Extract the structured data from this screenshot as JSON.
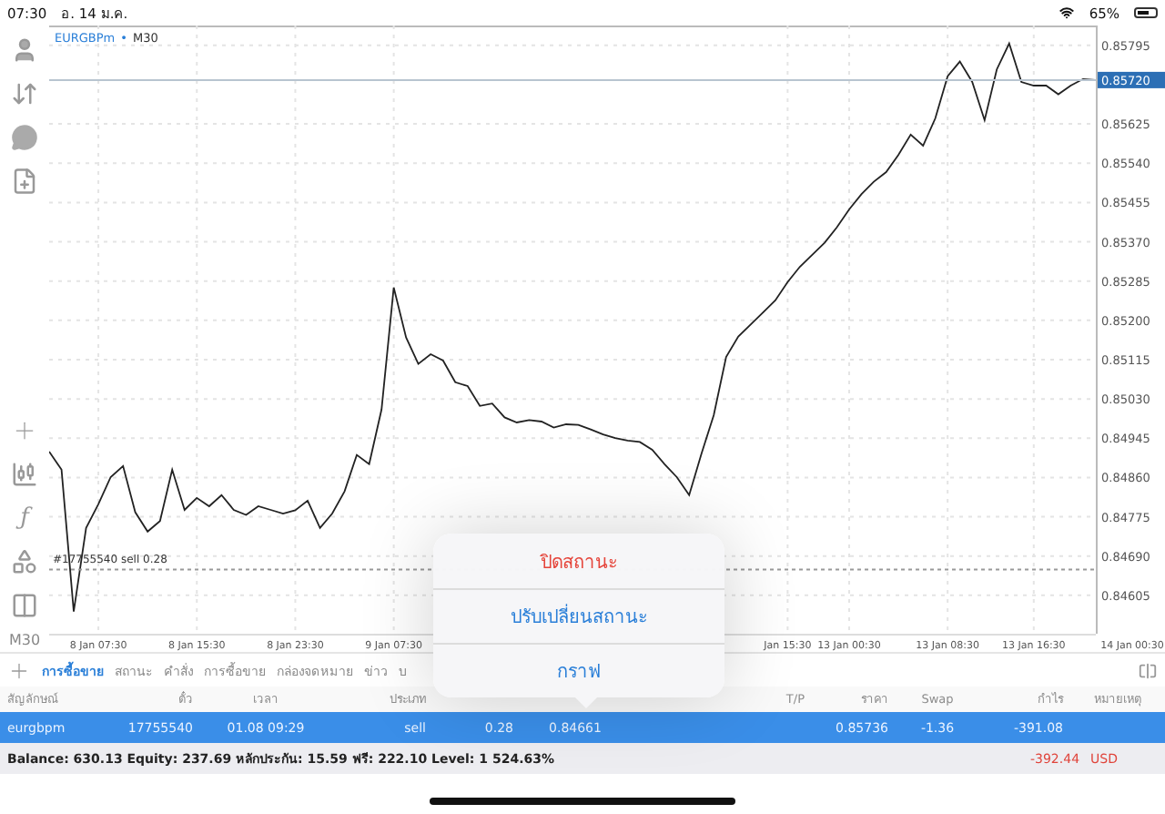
{
  "status_bar": {
    "time": "07:30",
    "date": "อ. 14 ม.ค.",
    "battery": "65%"
  },
  "toolbar": {
    "indicator": "ƒ",
    "timeframe": "M30"
  },
  "chart": {
    "symbol": "EURGBPm",
    "separator": "•",
    "timeframe": "M30",
    "chart_data": {
      "type": "line",
      "categories": [
        null,
        null,
        null,
        null,
        "8 Jan 07:30",
        null,
        null,
        null,
        null,
        null,
        null,
        null,
        "8 Jan 15:30",
        null,
        null,
        null,
        null,
        null,
        null,
        null,
        "8 Jan 23:30",
        null,
        null,
        null,
        null,
        null,
        null,
        null,
        "9 Jan 07:30",
        null,
        null,
        null,
        null,
        null,
        null,
        null,
        null,
        null,
        null,
        null,
        null,
        null,
        null,
        null,
        null,
        null,
        null,
        null,
        null,
        null,
        null,
        null,
        null,
        null,
        null,
        null,
        null,
        null,
        null,
        null,
        "Jan 15:30",
        null,
        null,
        null,
        null,
        "13 Jan 00:30",
        null,
        null,
        null,
        null,
        null,
        null,
        null,
        "13 Jan 08:30",
        null,
        null,
        null,
        null,
        null,
        null,
        "13 Jan 16:30",
        null,
        null,
        null,
        null,
        null,
        null,
        null,
        "14 Jan 00:30"
      ],
      "grid": true,
      "series": [
        {
          "color": "#222222",
          "values": [
            0.84916,
            0.84877,
            0.8457,
            0.84751,
            0.84802,
            0.84861,
            0.84885,
            0.84785,
            0.84743,
            0.84766,
            0.84877,
            0.8479,
            0.84816,
            0.84798,
            0.84822,
            0.8479,
            0.84779,
            0.84798,
            0.8479,
            0.84782,
            0.84789,
            0.8481,
            0.84751,
            0.84782,
            0.8483,
            0.84909,
            0.84889,
            0.85007,
            0.85271,
            0.85163,
            0.85106,
            0.85127,
            0.85113,
            0.85066,
            0.85058,
            0.85015,
            0.8502,
            0.8499,
            0.84979,
            0.84984,
            0.84981,
            0.84968,
            0.84975,
            0.84974,
            0.84964,
            0.84953,
            0.84945,
            0.8494,
            0.84937,
            0.8492,
            0.84889,
            0.84861,
            0.84822,
            0.84912,
            0.84995,
            0.85121,
            0.85165,
            0.85191,
            0.85217,
            0.85243,
            0.85283,
            0.85316,
            0.85342,
            0.85368,
            0.85401,
            0.8544,
            0.85473,
            0.855,
            0.85521,
            0.85558,
            0.85602,
            0.85578,
            0.85637,
            0.85728,
            0.8576,
            0.85716,
            0.85633,
            0.85743,
            0.85799,
            0.85716,
            0.85708,
            0.85708,
            0.85689,
            0.85708,
            0.85722,
            0.8572,
            null,
            null,
            null
          ]
        }
      ],
      "ylim": [
        0.84522,
        0.85838
      ],
      "yticks": [
        {
          "value": 0.85795,
          "label": "0.85795"
        },
        {
          "value": 0.85625,
          "label": "0.85625"
        },
        {
          "value": 0.8554,
          "label": "0.85540"
        },
        {
          "value": 0.85455,
          "label": "0.85455"
        },
        {
          "value": 0.8537,
          "label": "0.85370"
        },
        {
          "value": 0.85285,
          "label": "0.85285"
        },
        {
          "value": 0.852,
          "label": "0.85200"
        },
        {
          "value": 0.85115,
          "label": "0.85115"
        },
        {
          "value": 0.8503,
          "label": "0.85030"
        },
        {
          "value": 0.84945,
          "label": "0.84945"
        },
        {
          "value": 0.8486,
          "label": "0.84860"
        },
        {
          "value": 0.84775,
          "label": "0.84775"
        },
        {
          "value": 0.8469,
          "label": "0.84690"
        },
        {
          "value": 0.84605,
          "label": "0.84605"
        }
      ],
      "ref_lines": [
        {
          "axis": "y",
          "value": 0.8572,
          "label": "0.85720"
        },
        {
          "axis": "y",
          "value": 0.84661,
          "label": "#17755540 sell 0.28"
        }
      ]
    }
  },
  "tabs": [
    {
      "label": "การซื้อขาย",
      "selected": true
    },
    {
      "label": "สถานะ",
      "selected": false
    },
    {
      "label": "คำสั่ง",
      "selected": false
    },
    {
      "label": "การซื้อขาย",
      "selected": false
    },
    {
      "label": "กล่องจดหมาย",
      "selected": false
    },
    {
      "label": "ข่าว",
      "selected": false
    },
    {
      "label": "บ",
      "selected": false
    }
  ],
  "table": {
    "columns": [
      "สัญลักษณ์",
      "ตั๋ว",
      "เวลา",
      "ประเภท",
      null,
      null,
      null,
      "T/P",
      "ราคา",
      "Swap",
      "กำไร",
      "หมายเหตุ"
    ],
    "rows": [
      {
        "selected": true,
        "cells": [
          "eurgbpm",
          "17755540",
          "01.08 09:29",
          "sell",
          "0.28",
          "0.84661",
          null,
          null,
          "0.85736",
          "-1.36",
          "-391.08",
          null
        ]
      }
    ]
  },
  "summary": {
    "text": "Balance: 630.13 Equity: 237.69 หลักประกัน: 15.59 ฟรี: 222.10 Level: 1 524.63%",
    "total": "-392.44",
    "currency": "USD"
  },
  "popup": {
    "items": [
      {
        "label": "ปิดสถานะ",
        "kind": "destructive"
      },
      {
        "label": "ปรับเปลี่ยนสถานะ",
        "kind": "default"
      },
      {
        "label": "กราฟ",
        "kind": "default"
      }
    ]
  }
}
